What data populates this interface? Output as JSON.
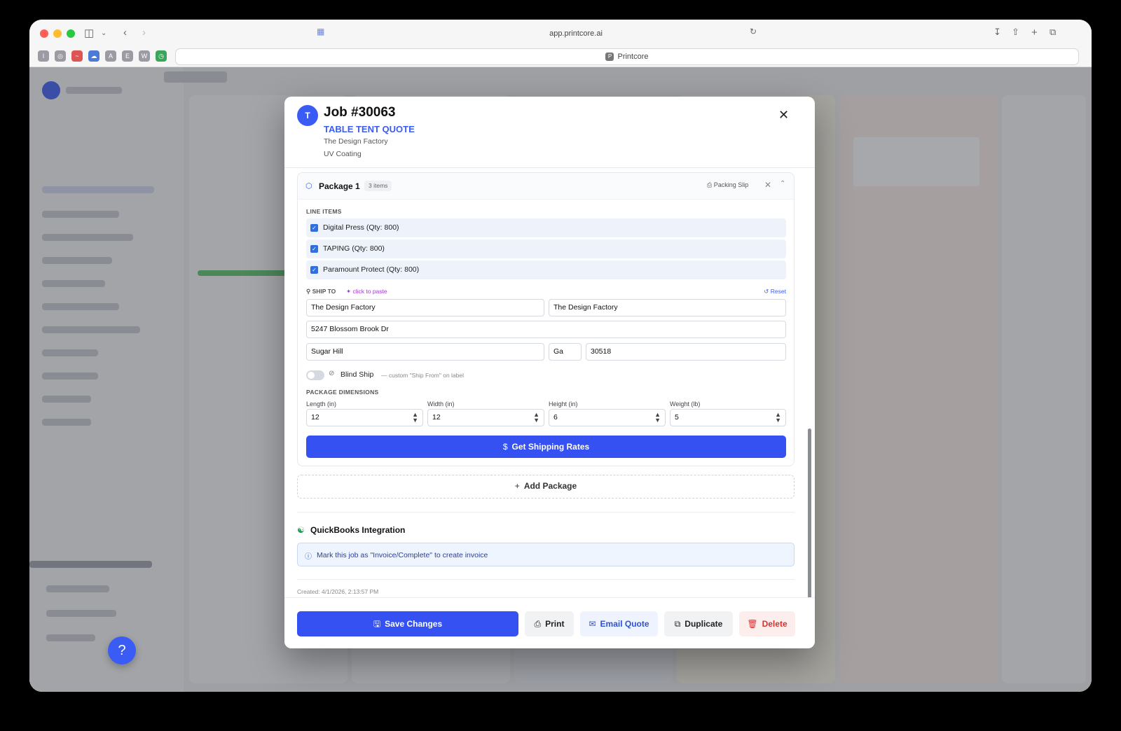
{
  "browser": {
    "url": "app.printcore.ai",
    "tab_title": "Printcore",
    "tab_favicon": "P",
    "favorites": [
      "I",
      "◎",
      "~",
      "☁",
      "A",
      "E",
      "W",
      "◷"
    ]
  },
  "modal": {
    "avatar": "T",
    "job_title": "Job #30063",
    "job_type": "TABLE TENT QUOTE",
    "client": "The Design Factory",
    "coating": "UV Coating",
    "close": "✕"
  },
  "package": {
    "title": "Package 1",
    "badge": "3 items",
    "packing_slip": "Packing Slip",
    "line_items_label": "LINE ITEMS",
    "line_items": [
      {
        "label": "Digital Press (Qty: 800)",
        "checked": true
      },
      {
        "label": "TAPING (Qty: 800)",
        "checked": true
      },
      {
        "label": "Paramount Protect (Qty: 800)",
        "checked": true
      }
    ],
    "ship_to_label": "SHIP TO",
    "paste_label": "click to paste",
    "reset_label": "Reset",
    "ship_to": {
      "name": "The Design Factory",
      "company": "The Design Factory",
      "street": "5247 Blossom Brook Dr",
      "city": "Sugar Hill",
      "state": "Ga",
      "zip": "30518"
    },
    "blind_ship_label": "Blind Ship",
    "blind_ship_note": "— custom \"Ship From\" on label",
    "blind_ship_on": false,
    "dimensions_label": "PACKAGE DIMENSIONS",
    "dimensions": [
      {
        "label": "Length (in)",
        "value": "12"
      },
      {
        "label": "Width (in)",
        "value": "12"
      },
      {
        "label": "Height (in)",
        "value": "6"
      },
      {
        "label": "Weight (lb)",
        "value": "5"
      }
    ],
    "rates_button": "Get Shipping Rates"
  },
  "add_package": "Add Package",
  "quickbooks": {
    "title": "QuickBooks Integration",
    "info": "Mark this job as \"Invoice/Complete\" to create invoice"
  },
  "created": "Created: 4/1/2026, 2:13:57 PM",
  "footer": {
    "save": "Save Changes",
    "print": "Print",
    "email": "Email Quote",
    "duplicate": "Duplicate",
    "delete": "Delete"
  },
  "colors": {
    "accent": "#3551f2",
    "danger": "#d8302e",
    "paste": "#a23ad6",
    "quickbooks": "#1e9e4a"
  }
}
